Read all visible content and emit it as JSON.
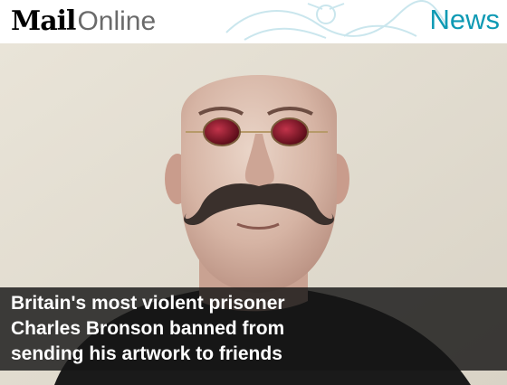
{
  "header": {
    "logo_mail": "Mail",
    "logo_online": "Online",
    "section": "News"
  },
  "article": {
    "headline": "Britain's most violent prisoner Charles Bronson banned from sending his artwork to friends"
  },
  "colors": {
    "accent": "#0f9ab4",
    "caption_bg": "#161616"
  },
  "icons": {
    "watermark": "coat-of-arms-icon"
  }
}
